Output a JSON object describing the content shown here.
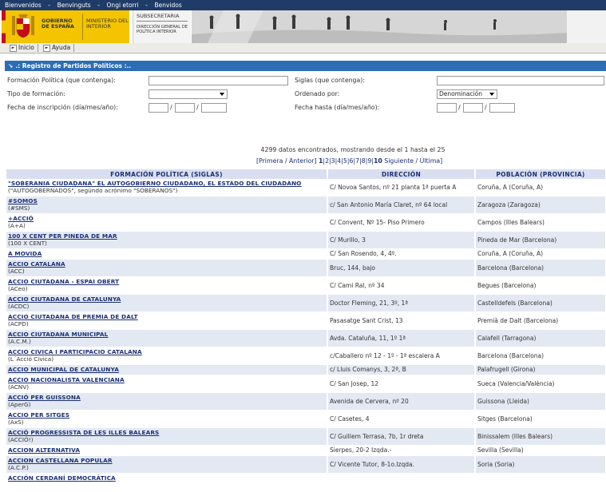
{
  "top_links": [
    "Bienvenidos",
    "Benvinguts",
    "Ongi etorri",
    "Benvidos"
  ],
  "header": {
    "gobierno": "GOBIERNO DE ESPAÑA",
    "ministerio": "MINISTERIO DEL INTERIOR",
    "subsecretaria": "SUBSECRETARIA",
    "direccion": "DIRECCIÓN GENERAL DE POLÍTICA INTERIOR"
  },
  "nav": {
    "inicio": "Inicio",
    "ayuda": "Ayuda"
  },
  "form": {
    "title": ".: Registro de Partidos Políticos :..",
    "formacion_label": "Formación Política (que contenga):",
    "siglas_label": "Siglas (que contenga):",
    "tipo_label": "Tipo de formación:",
    "ordenado_label": "Ordenado por:",
    "ordenado_value": "Denominación",
    "fecha_insc_label": "Fecha de inscripción (día/mes/año):",
    "fecha_hasta_label": "Fecha hasta (día/mes/año):"
  },
  "results": {
    "count_text": "4299 datos encontrados, mostrando desde el 1 hasta el 25",
    "pager_first": "[Primera",
    "pager_sep": "/",
    "pager_prev": "Anterior]",
    "pages": [
      "1",
      "2",
      "3",
      "4",
      "5",
      "6",
      "7",
      "8",
      "9",
      "10"
    ],
    "pager_next": "Siguiente",
    "pager_last": "Última]"
  },
  "table": {
    "headers": [
      "FORMACIÓN POLÍTICA (SIGLAS)",
      "DIRECCIÓN",
      "POBLACIÓN (PROVINCIA)"
    ],
    "rows": [
      {
        "name": "\"SOBERANIA CIUDADANA\" EL AUTOGOBIERNO CIUDADANO, EL ESTADO DEL CIUDADANO",
        "siglas": "(\"AUTOGOBERNADOS\", segúndo acrónimo \"SOBERANOS\")",
        "dir": "C/ Novoa Santos, nº 21 planta 1ª puerta A",
        "pob": "Coruña, A (Coruña, A)"
      },
      {
        "name": "#SOMOS",
        "siglas": "(#SMS)",
        "dir": "c/ San Antonio María Claret, nº 64 local",
        "pob": "Zaragoza (Zaragoza)"
      },
      {
        "name": "+ACCIÓ",
        "siglas": "(A+A)",
        "dir": "C/ Convent, Nº 15- Piso Primero",
        "pob": "Campos (Illes Balears)"
      },
      {
        "name": "100 X CENT PER PINEDA DE MAR",
        "siglas": "(100 X CENT)",
        "dir": "C/ Murillo, 3",
        "pob": "Pineda de Mar (Barcelona)"
      },
      {
        "name": "A MOVIDA",
        "siglas": "",
        "dir": "C/ San Rosendo, 4, 4º.",
        "pob": "Coruña, A (Coruña, A)"
      },
      {
        "name": "ACCIO CATALANA",
        "siglas": "(ACC)",
        "dir": "Bruc, 144, bajo",
        "pob": "Barcelona (Barcelona)"
      },
      {
        "name": "ACCIO CIUTADANA - ESPAI OBERT",
        "siglas": "(ACeo)",
        "dir": "C/ Cami Ral, nº 34",
        "pob": "Begues (Barcelona)"
      },
      {
        "name": "ACCIO CIUTADANA DE CATALUNYA",
        "siglas": "(ACDC)",
        "dir": "Doctor Fleming, 21, 3º, 1ª",
        "pob": "Castelldefels (Barcelona)"
      },
      {
        "name": "ACCIO CIUTADANA DE PREMIA DE DALT",
        "siglas": "(ACPD)",
        "dir": "Pasasatge Sant Crist, 13",
        "pob": "Premià de Dalt (Barcelona)"
      },
      {
        "name": "ACCIO CIUTADANA MUNICIPAL",
        "siglas": "(A.C.M.)",
        "dir": "Avda. Cataluña, 11, 1º 1ª",
        "pob": "Calafell (Tarragona)"
      },
      {
        "name": "ACCIO CIVICA I PARTICIPACIO CATALANA",
        "siglas": "(L´Acció Cívica)",
        "dir": "c/Caballero nº 12 - 1º - 1ª escalera A",
        "pob": "Barcelona (Barcelona)"
      },
      {
        "name": "ACCIO MUNICIPAL DE CATALUNYA",
        "siglas": "",
        "dir": "c/ Lluis Comanys, 3, 2ª, B",
        "pob": "Palafrugell (Girona)"
      },
      {
        "name": "ACCIO NACIONALISTA VALENCIANA",
        "siglas": "(ACNV)",
        "dir": "C/ San Josep, 12",
        "pob": "Sueca (Valencia/València)"
      },
      {
        "name": "ACCIÓ PER GUISSONA",
        "siglas": "(AperG)",
        "dir": "Avenida de Cervera, nº 20",
        "pob": "Guissona (Lleida)"
      },
      {
        "name": "ACCIO PER SITGES",
        "siglas": "(AxS)",
        "dir": "C/ Casetes, 4",
        "pob": "Sitges (Barcelona)"
      },
      {
        "name": "ACCIÓ PROGRESSISTA DE LES ILLES BALEARS",
        "siglas": "(ACCIÓ!)",
        "dir": "C/ Guillem Terrasa, 7b, 1r dreta",
        "pob": "Binissalem (Illes Balears)"
      },
      {
        "name": "ACCION ALTERNATIVA",
        "siglas": "",
        "dir": "Sierpes, 20-2 Izqda.-",
        "pob": "Sevilla (Sevilla)"
      },
      {
        "name": "ACCION CASTELLANA POPULAR",
        "siglas": "(A.C.P.)",
        "dir": "C/ Vicente Tutor, 8-1o.Izqda.",
        "pob": "Soria (Soria)"
      },
      {
        "name": "ACCIÓN CERDANÍ DEMOCRÁTICA",
        "siglas": "",
        "dir": "",
        "pob": ""
      }
    ]
  }
}
